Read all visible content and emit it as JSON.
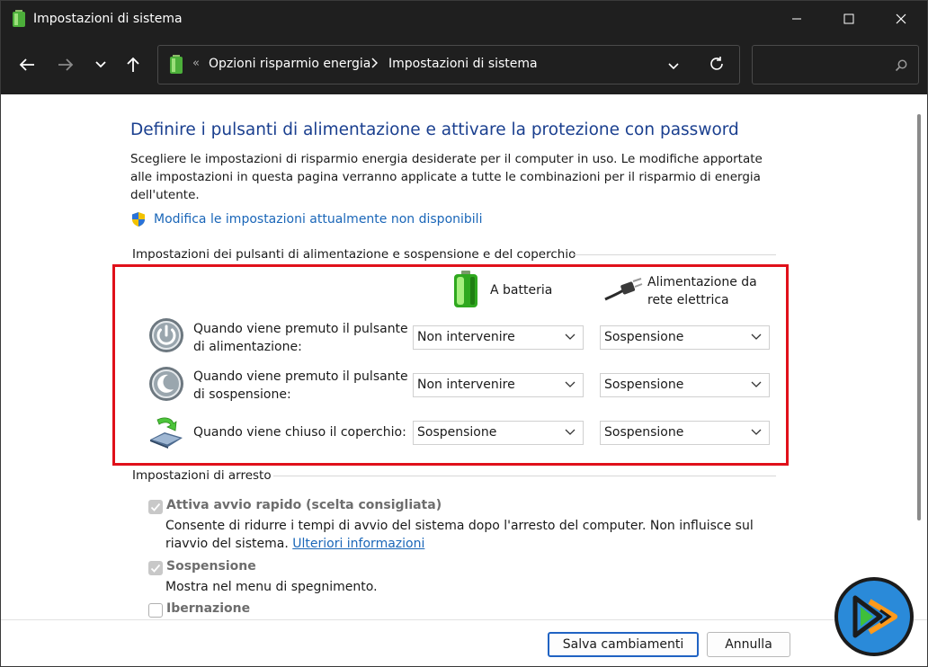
{
  "window": {
    "title": "Impostazioni di sistema"
  },
  "address_bar": {
    "separator": "«",
    "crumb_1": "Opzioni risparmio energia",
    "crumb_2": "Impostazioni di sistema",
    "search_placeholder": ""
  },
  "main": {
    "heading": "Definire i pulsanti di alimentazione e attivare la protezione con password",
    "description": "Scegliere le impostazioni di risparmio energia desiderate per il computer in uso. Le modifiche apportate alle impostazioni in questa pagina verranno applicate a tutte le combinazioni per il risparmio di energia dell'utente.",
    "modify_link": "Modifica le impostazioni attualmente non disponibili",
    "buttons_section": {
      "title": "Impostazioni dei pulsanti di alimentazione e sospensione e del coperchio",
      "col_battery": "A batteria",
      "col_ac": "Alimentazione da rete elettrica",
      "rows": [
        {
          "label": "Quando viene premuto il pulsante di alimentazione:",
          "battery": "Non intervenire",
          "ac": "Sospensione"
        },
        {
          "label": "Quando viene premuto il pulsante di sospensione:",
          "battery": "Non intervenire",
          "ac": "Sospensione"
        },
        {
          "label": "Quando viene chiuso il coperchio:",
          "battery": "Sospensione",
          "ac": "Sospensione"
        }
      ]
    },
    "shutdown_section": {
      "title": "Impostazioni di arresto",
      "items": [
        {
          "label": "Attiva avvio rapido (scelta consigliata)",
          "checked": true,
          "desc": "Consente di ridurre i tempi di avvio del sistema dopo l'arresto del computer. Non influisce sul riavvio del sistema.",
          "link": "Ulteriori informazioni"
        },
        {
          "label": "Sospensione",
          "checked": true,
          "desc": "Mostra nel menu di spegnimento."
        },
        {
          "label": "Ibernazione",
          "checked": false
        }
      ]
    }
  },
  "footer": {
    "save": "Salva cambiamenti",
    "cancel": "Annulla"
  },
  "colors": {
    "heading": "#1a3f8f",
    "link": "#1a66b8",
    "highlight_box": "#e0101a",
    "primary_button_border": "#2063c3"
  }
}
